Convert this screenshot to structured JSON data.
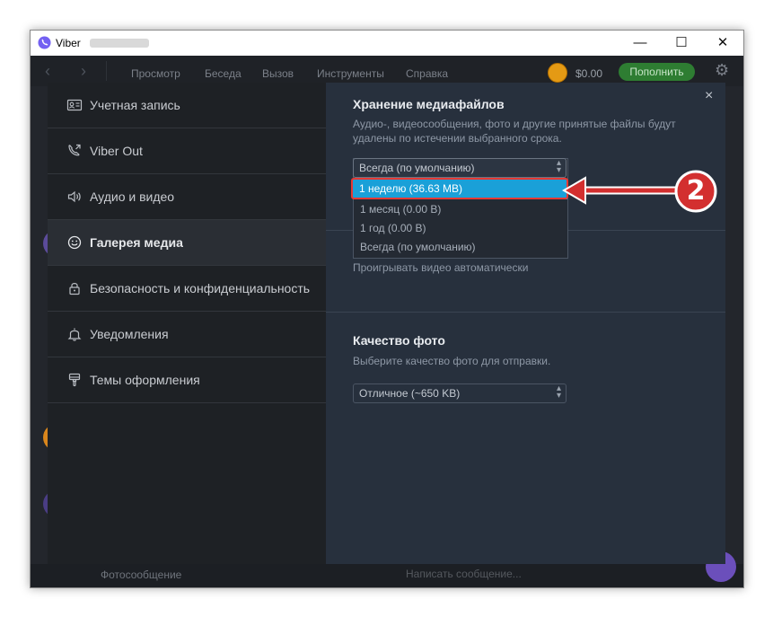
{
  "window": {
    "app_name": "Viber",
    "controls": {
      "minimize": "—",
      "maximize": "☐",
      "close": "✕"
    }
  },
  "menu": {
    "back": "‹",
    "forward": "›",
    "items": [
      "Просмотр",
      "Беседа",
      "Вызов",
      "Инструменты",
      "Справка"
    ],
    "balance": "$0.00",
    "topup": "Пополнить"
  },
  "background": {
    "photo_message": "Фотосообщение",
    "compose_placeholder": "Написать сообщение..."
  },
  "sidebar": {
    "items": [
      {
        "label": "Учетная запись",
        "icon": "account-card-icon",
        "active": false
      },
      {
        "label": "Viber Out",
        "icon": "phone-out-icon",
        "active": false
      },
      {
        "label": "Аудио и видео",
        "icon": "speaker-icon",
        "active": false
      },
      {
        "label": "Галерея медиа",
        "icon": "smiley-icon",
        "active": true
      },
      {
        "label": "Безопасность и конфиденциальность",
        "icon": "lock-icon",
        "active": false
      },
      {
        "label": "Уведомления",
        "icon": "bell-icon",
        "active": false
      },
      {
        "label": "Темы оформления",
        "icon": "brush-icon",
        "active": false
      }
    ]
  },
  "content": {
    "close": "×",
    "storage": {
      "title": "Хранение медиафайлов",
      "description": "Аудио-, видеосообщения, фото и другие принятые файлы будут удалены по истечении выбранного срока.",
      "selected": "Всегда (по умолчанию)",
      "options": [
        "1 неделю (36.63 MB)",
        "1 месяц (0.00 B)",
        "1 год (0.00 B)",
        "Всегда (по умолчанию)"
      ],
      "highlighted_index": 0
    },
    "autoplay_label": "Проигрывать видео автоматически",
    "photo_quality": {
      "title": "Качество фото",
      "description": "Выберите качество фото для отправки.",
      "selected": "Отличное (~650 KB)"
    }
  },
  "annotation": {
    "step_number": "2"
  },
  "colors": {
    "highlight": "#1aa0d8",
    "annotation_red": "#d32f2f",
    "viber_purple": "#7360f2",
    "content_bg": "#27303d",
    "sidebar_bg": "#1e2125"
  }
}
